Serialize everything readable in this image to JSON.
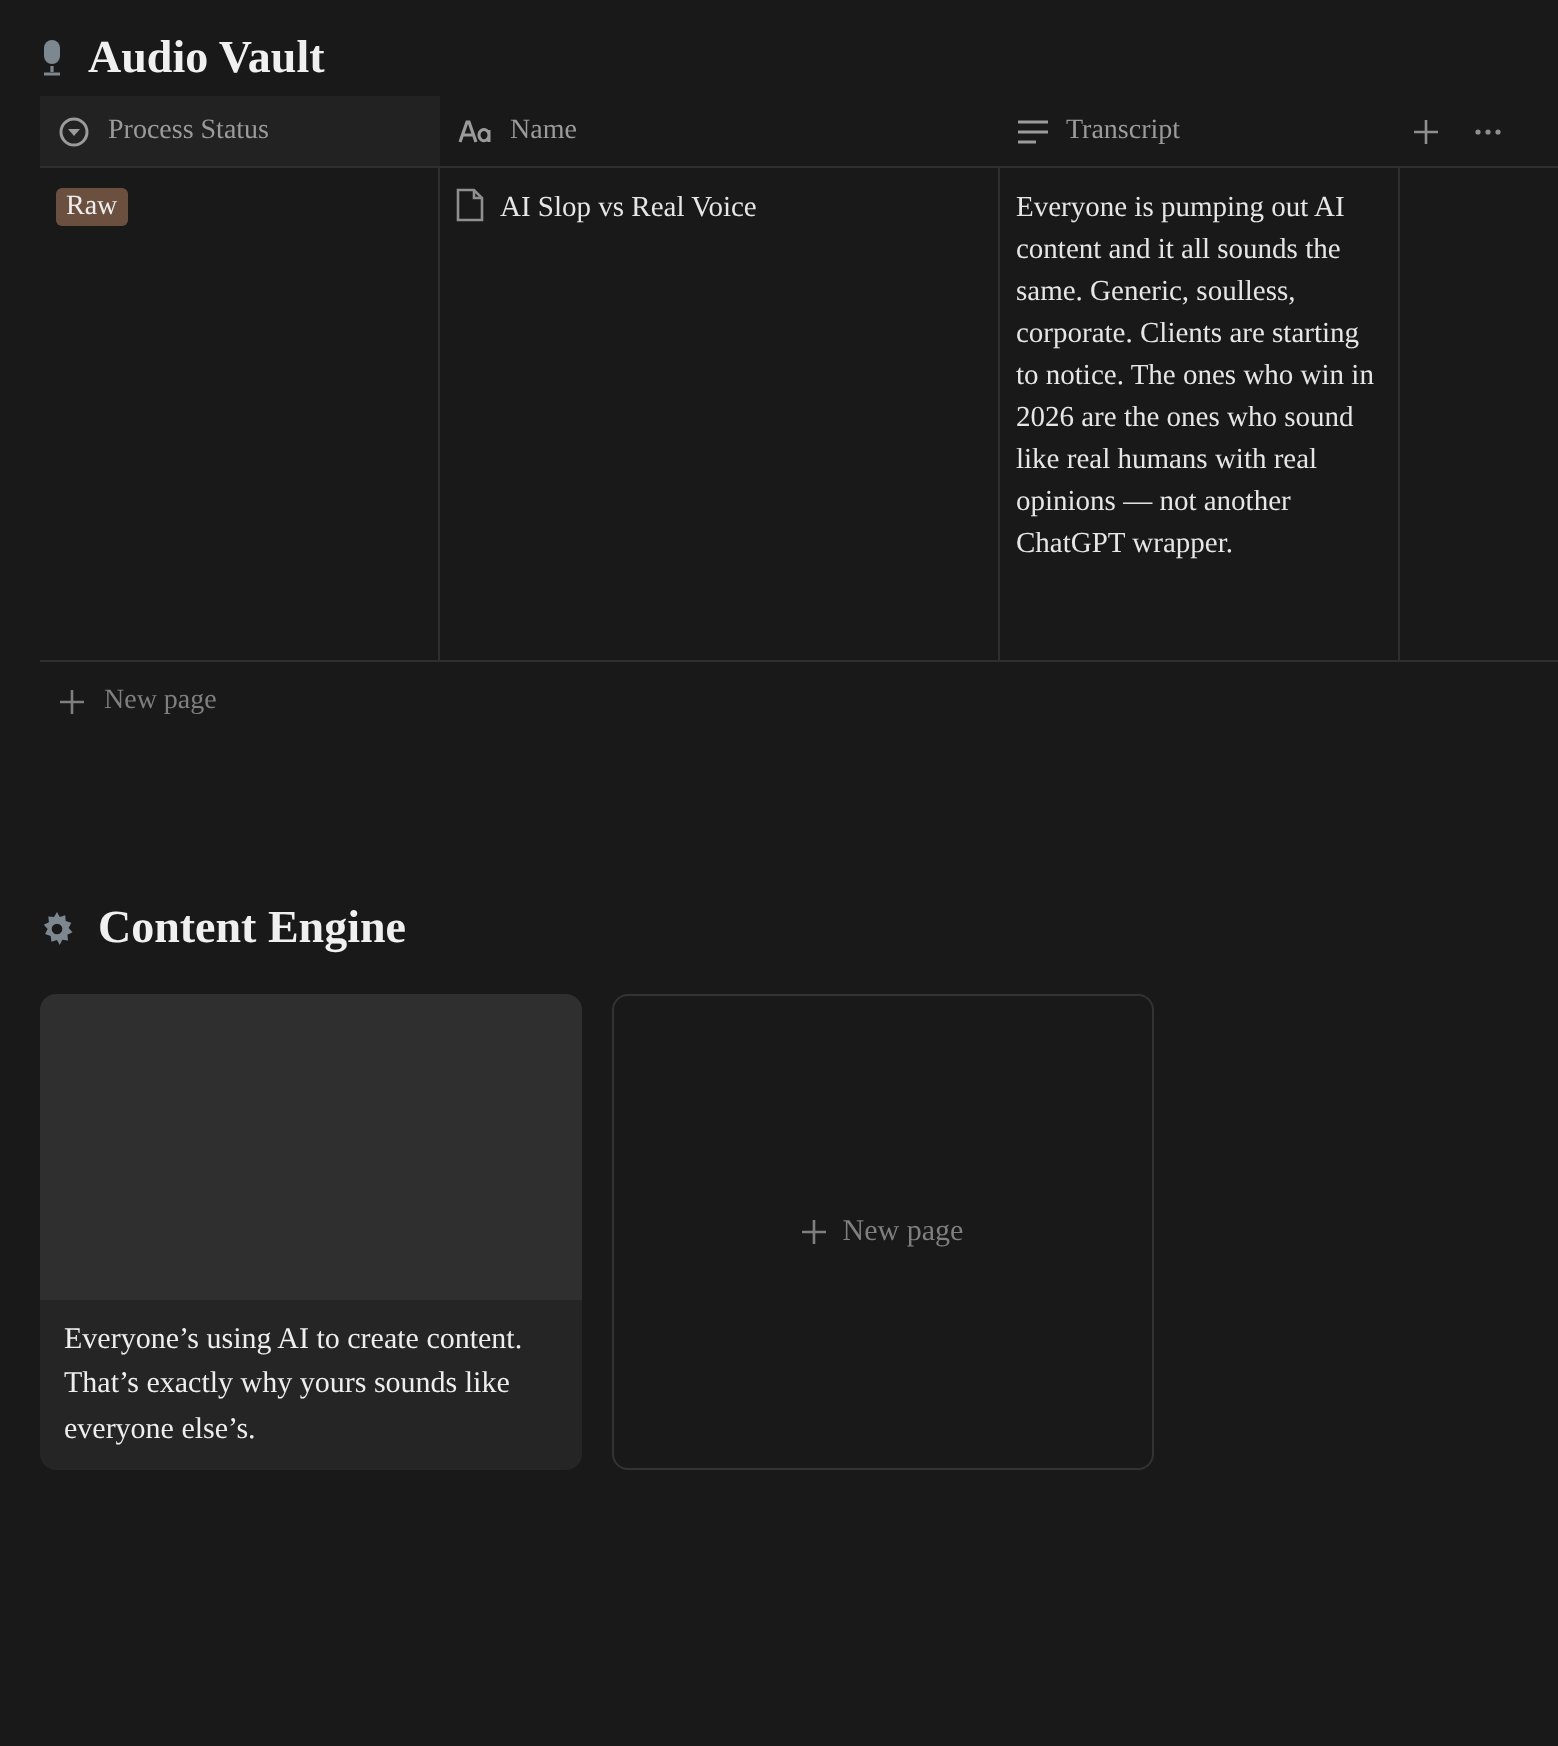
{
  "audio_vault": {
    "title": "Audio Vault",
    "columns": [
      {
        "label": "Process Status",
        "kind": "status"
      },
      {
        "label": "Name",
        "kind": "title"
      },
      {
        "label": "Transcript",
        "kind": "text"
      }
    ],
    "rows": [
      {
        "status": {
          "label": "Raw",
          "color": "#6b5040"
        },
        "name": "AI Slop vs Real Voice",
        "transcript": "Everyone is pumping out AI content and it all sounds the same. Generic, soulless, corporate. Clients are starting to notice. The ones who win in 2026 are the ones who sound like real humans with real opinions — not another ChatGPT wrapper."
      }
    ],
    "add_row": "New page"
  },
  "content_engine": {
    "title": "Content Engine",
    "cards": [
      {
        "kind": "page",
        "text": "Everyone’s using AI to create content. That’s exactly why yours sounds like everyone else’s."
      },
      {
        "kind": "new",
        "text": "New page"
      }
    ]
  }
}
